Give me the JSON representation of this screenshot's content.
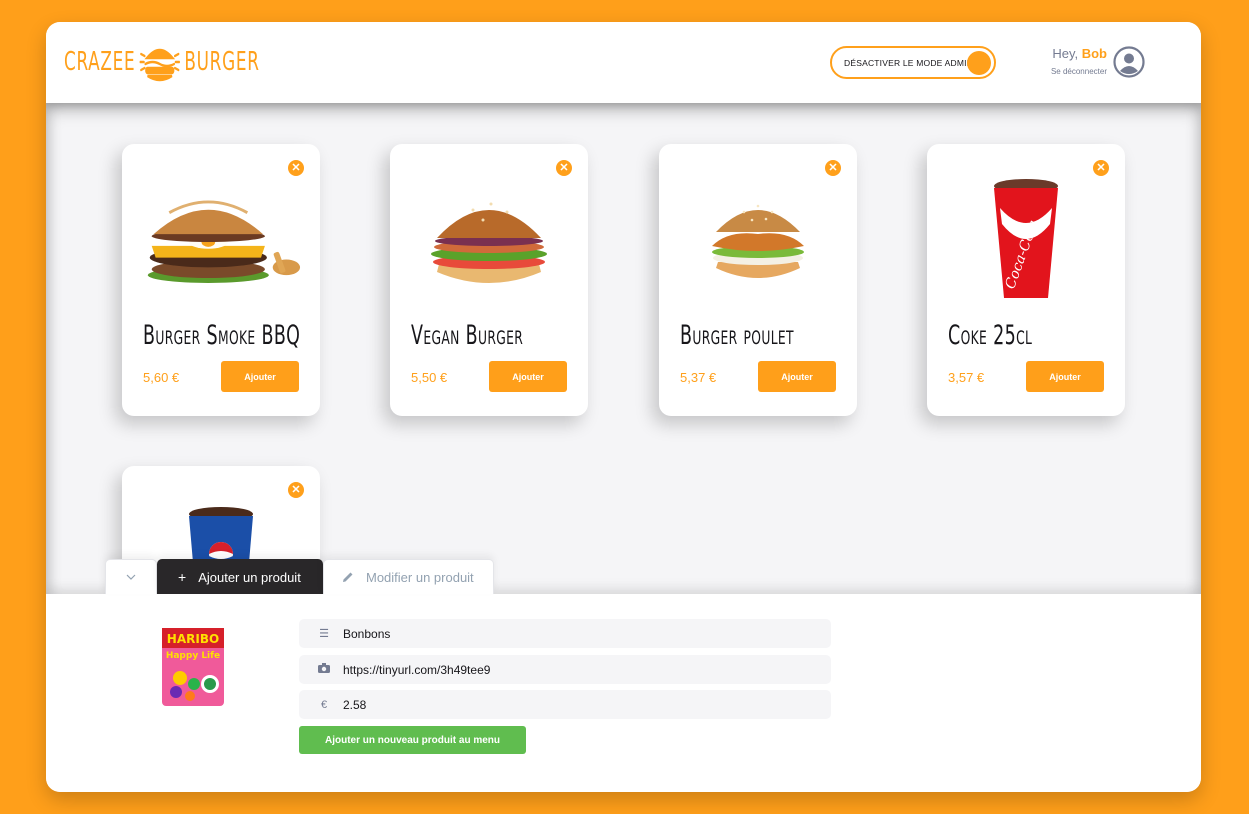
{
  "navbar": {
    "logo_left": "CRAZEE",
    "logo_right": "BURGER",
    "admin_toggle_label": "DÉSACTIVER LE MODE ADMIN",
    "greeting": "Hey, ",
    "username": "Bob",
    "logout": "Se déconnecter"
  },
  "products": [
    {
      "title": "Burger Smoke BBQ",
      "price": "5,60 €",
      "add_label": "Ajouter",
      "image": "burger-bbq"
    },
    {
      "title": "Vegan Burger",
      "price": "5,50 €",
      "add_label": "Ajouter",
      "image": "vegan-burger"
    },
    {
      "title": "Burger poulet",
      "price": "5,37 €",
      "add_label": "Ajouter",
      "image": "chicken-burger"
    },
    {
      "title": "Coke 25cl",
      "price": "3,57 €",
      "add_label": "Ajouter",
      "image": "coke-cup"
    },
    {
      "title": "",
      "price": "",
      "add_label": "",
      "image": "pepsi-cup"
    }
  ],
  "admin": {
    "tabs": {
      "collapse_icon": "chevron-down-icon",
      "add": "Ajouter un produit",
      "edit": "Modifier un produit"
    },
    "form": {
      "name_value": "Bonbons",
      "image_value": "https://tinyurl.com/3h49tee9",
      "price_value": "2.58",
      "submit_label": "Ajouter un nouveau produit au menu"
    }
  },
  "colors": {
    "primary": "#ff9f1a",
    "dark": "#292729",
    "success": "#60bd4f",
    "background": "#f5f5f7"
  }
}
